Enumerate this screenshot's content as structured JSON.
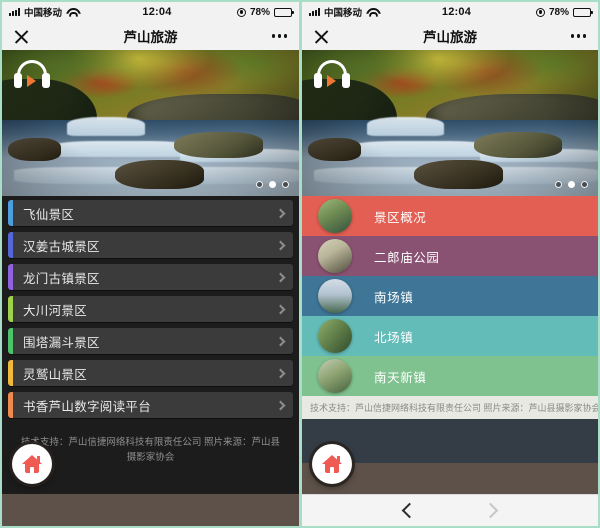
{
  "meta": {
    "app_title": "芦山旅游"
  },
  "status_bar": {
    "carrier": "中国移动",
    "time": "12:04",
    "battery_percent": "78%",
    "signal_icon": "signal-bars-icon",
    "wifi_icon": "wifi-icon",
    "location_icon": "location-services-icon",
    "battery_icon": "battery-icon"
  },
  "nav_bar": {
    "close_icon": "close-x-icon",
    "title": "芦山旅游",
    "menu_icon": "more-options-icon"
  },
  "hero": {
    "audio_icon": "headphones-play-icon",
    "alt": "芦山溪流秋景",
    "pager": {
      "count": 3,
      "active_index": 1
    }
  },
  "left_panel": {
    "list": [
      {
        "label": "飞仙景区",
        "accent": "#4d9ede"
      },
      {
        "label": "汉姜古城景区",
        "accent": "#5566d8"
      },
      {
        "label": "龙门古镇景区",
        "accent": "#8f63e0"
      },
      {
        "label": "大川河景区",
        "accent": "#9fd14a"
      },
      {
        "label": "围塔漏斗景区",
        "accent": "#4ec46a"
      },
      {
        "label": "灵鹫山景区",
        "accent": "#f0b93c"
      },
      {
        "label": "书香芦山数字阅读平台",
        "accent": "#ef8a4f"
      }
    ],
    "chevron_icon": "chevron-right-icon",
    "credit": "技术支持：芦山信捷网络科技有限责任公司 照片来源：芦山县摄影家协会"
  },
  "right_panel": {
    "list": [
      {
        "label": "景区概况",
        "bg": "#e35f53",
        "thumb_a": "#6e8a52",
        "thumb_b": "#3c5a4a"
      },
      {
        "label": "二郎庙公园",
        "bg": "#8a5272",
        "thumb_a": "#b9b59a",
        "thumb_b": "#5d5a4a"
      },
      {
        "label": "南场镇",
        "bg": "#3f7596",
        "thumb_a": "#b9c9d6",
        "thumb_b": "#47694f"
      },
      {
        "label": "北场镇",
        "bg": "#63bcb8",
        "thumb_a": "#7d9a5e",
        "thumb_b": "#3d5a3a"
      },
      {
        "label": "南天新镇",
        "bg": "#7fc28f",
        "thumb_a": "#9fb27e",
        "thumb_b": "#4d6a45"
      }
    ],
    "credit": "技术支持：芦山信捷网络科技有限责任公司 照片来源：芦山县摄影家协会"
  },
  "home_fab": {
    "icon": "home-icon",
    "label": "首页"
  },
  "bottom_nav": {
    "back_icon": "chevron-left-icon",
    "forward_icon": "chevron-right-icon"
  }
}
